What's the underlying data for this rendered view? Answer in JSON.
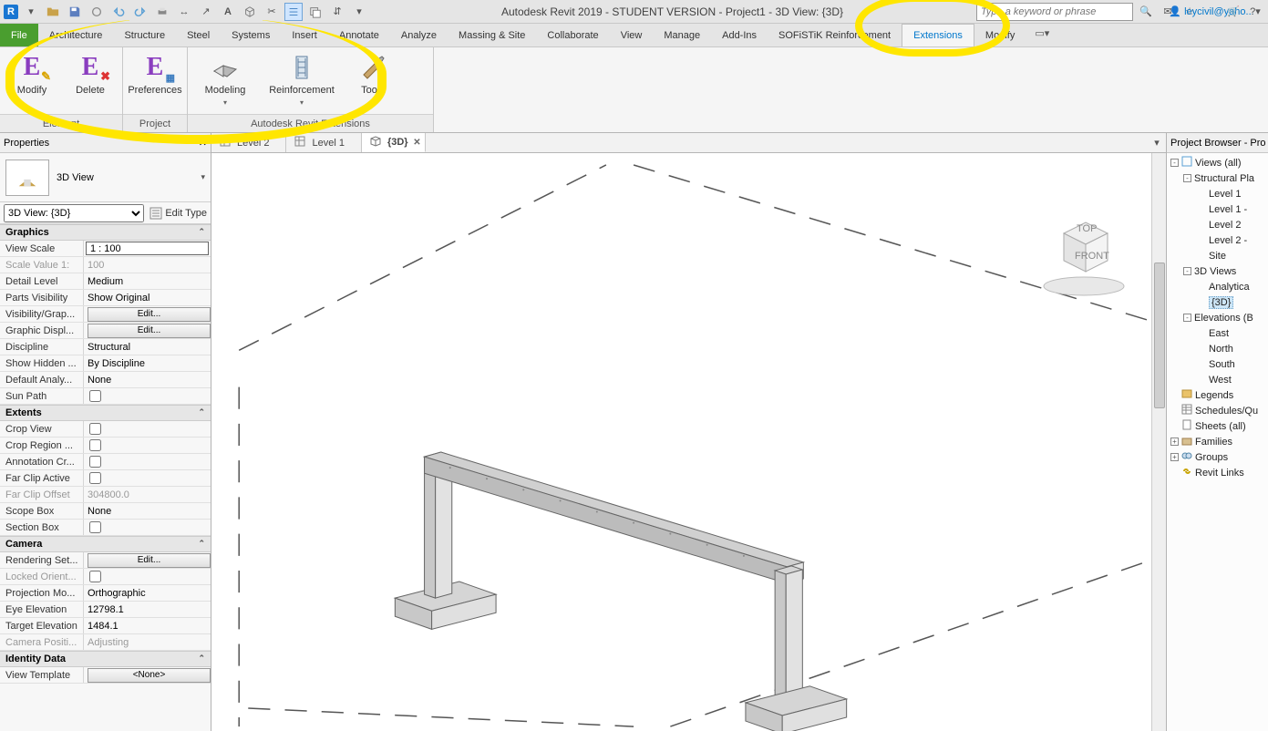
{
  "titlebar": {
    "app_title": "Autodesk Revit 2019 - STUDENT VERSION - Project1 - 3D View: {3D}",
    "search_placeholder": "Type a keyword or phrase",
    "user_label": "leycivil@yaho..."
  },
  "ribbon_tabs": {
    "file": "File",
    "items": [
      "Architecture",
      "Structure",
      "Steel",
      "Systems",
      "Insert",
      "Annotate",
      "Analyze",
      "Massing & Site",
      "Collaborate",
      "View",
      "Manage",
      "Add-Ins",
      "SOFiSTiK Reinforcement",
      "Extensions",
      "Modify"
    ],
    "active": "Extensions"
  },
  "ribbon_panels": {
    "element": {
      "title": "Element",
      "buttons": [
        "Modify",
        "Delete"
      ]
    },
    "project": {
      "title": "Project",
      "buttons": [
        "Preferences"
      ]
    },
    "ext": {
      "title": "Autodesk Revit Extensions",
      "buttons": [
        "Modeling",
        "Reinforcement",
        "Tools"
      ]
    }
  },
  "properties": {
    "title": "Properties",
    "type_name": "3D View",
    "instance": "3D View: {3D}",
    "edit_type": "Edit Type",
    "categories": [
      {
        "name": "Graphics",
        "rows": [
          {
            "k": "View Scale",
            "v": "1 : 100",
            "boxed": true
          },
          {
            "k": "Scale Value   1:",
            "v": "100",
            "dim": true
          },
          {
            "k": "Detail Level",
            "v": "Medium"
          },
          {
            "k": "Parts Visibility",
            "v": "Show Original"
          },
          {
            "k": "Visibility/Grap...",
            "v": "Edit...",
            "btn": true
          },
          {
            "k": "Graphic Displ...",
            "v": "Edit...",
            "btn": true
          },
          {
            "k": "Discipline",
            "v": "Structural"
          },
          {
            "k": "Show Hidden ...",
            "v": "By Discipline"
          },
          {
            "k": "Default Analy...",
            "v": "None"
          },
          {
            "k": "Sun Path",
            "v": "",
            "chk": true
          }
        ]
      },
      {
        "name": "Extents",
        "rows": [
          {
            "k": "Crop View",
            "v": "",
            "chk": true
          },
          {
            "k": "Crop Region ...",
            "v": "",
            "chk": true
          },
          {
            "k": "Annotation Cr...",
            "v": "",
            "chk": true
          },
          {
            "k": "Far Clip Active",
            "v": "",
            "chk": true
          },
          {
            "k": "Far Clip Offset",
            "v": "304800.0",
            "dim": true
          },
          {
            "k": "Scope Box",
            "v": "None"
          },
          {
            "k": "Section Box",
            "v": "",
            "chk": true
          }
        ]
      },
      {
        "name": "Camera",
        "rows": [
          {
            "k": "Rendering Set...",
            "v": "Edit...",
            "btn": true
          },
          {
            "k": "Locked Orient...",
            "v": "",
            "chk": true,
            "dim": true
          },
          {
            "k": "Projection Mo...",
            "v": "Orthographic"
          },
          {
            "k": "Eye Elevation",
            "v": "12798.1"
          },
          {
            "k": "Target Elevation",
            "v": "1484.1"
          },
          {
            "k": "Camera Positi...",
            "v": "Adjusting",
            "dim": true
          }
        ]
      },
      {
        "name": "Identity Data",
        "rows": [
          {
            "k": "View Template",
            "v": "<None>",
            "btn": true
          }
        ]
      }
    ]
  },
  "view_tabs": [
    {
      "icon": "plan",
      "label": "Level 2"
    },
    {
      "icon": "plan",
      "label": "Level 1"
    },
    {
      "icon": "cube",
      "label": "{3D}",
      "active": true,
      "close": true
    }
  ],
  "browser": {
    "title": "Project Browser - Pro",
    "tree": [
      {
        "d": 0,
        "tw": "-",
        "ic": "views",
        "lbl": "Views (all)"
      },
      {
        "d": 1,
        "tw": "-",
        "lbl": "Structural Pla"
      },
      {
        "d": 2,
        "lbl": "Level 1"
      },
      {
        "d": 2,
        "lbl": "Level 1 -"
      },
      {
        "d": 2,
        "lbl": "Level 2"
      },
      {
        "d": 2,
        "lbl": "Level 2 -"
      },
      {
        "d": 2,
        "lbl": "Site"
      },
      {
        "d": 1,
        "tw": "-",
        "lbl": "3D Views"
      },
      {
        "d": 2,
        "lbl": "Analytica"
      },
      {
        "d": 2,
        "lbl": "{3D}",
        "sel": true
      },
      {
        "d": 1,
        "tw": "-",
        "lbl": "Elevations (B"
      },
      {
        "d": 2,
        "lbl": "East"
      },
      {
        "d": 2,
        "lbl": "North"
      },
      {
        "d": 2,
        "lbl": "South"
      },
      {
        "d": 2,
        "lbl": "West"
      },
      {
        "d": 0,
        "ic": "legends",
        "lbl": "Legends"
      },
      {
        "d": 0,
        "ic": "sched",
        "lbl": "Schedules/Qu"
      },
      {
        "d": 0,
        "ic": "sheets",
        "lbl": "Sheets (all)"
      },
      {
        "d": 0,
        "tw": "+",
        "ic": "fam",
        "lbl": "Families"
      },
      {
        "d": 0,
        "tw": "+",
        "ic": "grp",
        "lbl": "Groups"
      },
      {
        "d": 0,
        "ic": "link",
        "lbl": "Revit Links"
      }
    ]
  }
}
